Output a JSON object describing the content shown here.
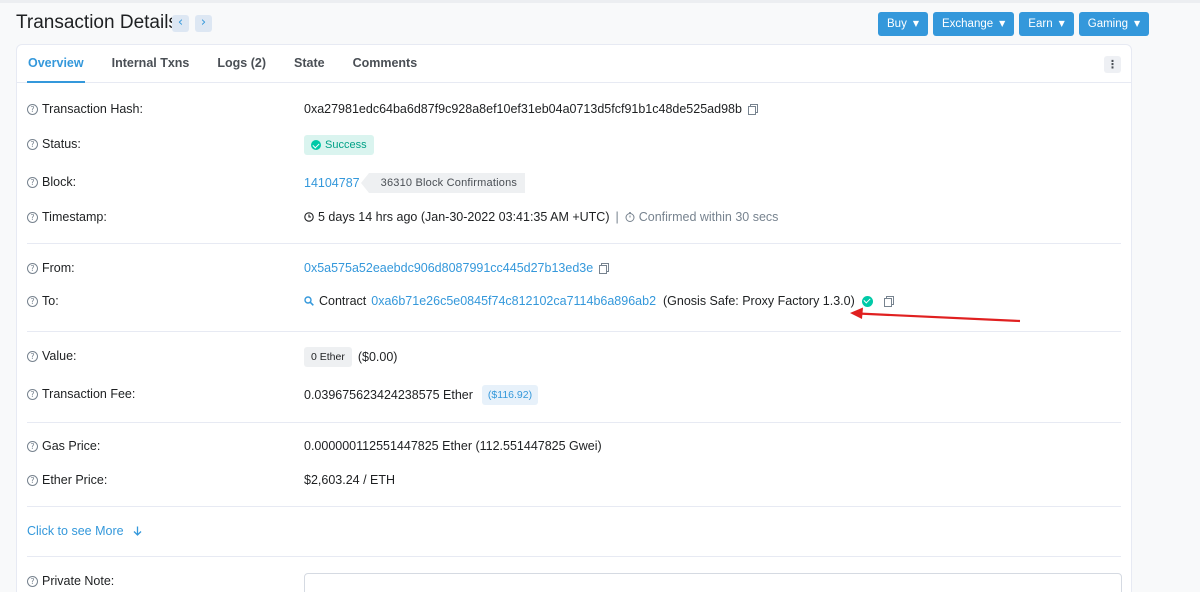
{
  "header": {
    "title": "Transaction Details",
    "prev_icon": "chevron-left-icon",
    "next_icon": "chevron-right-icon",
    "buttons": [
      {
        "label": "Buy"
      },
      {
        "label": "Exchange"
      },
      {
        "label": "Earn"
      },
      {
        "label": "Gaming"
      }
    ]
  },
  "tabs": [
    {
      "label": "Overview",
      "active": true
    },
    {
      "label": "Internal Txns"
    },
    {
      "label": "Logs (2)"
    },
    {
      "label": "State"
    },
    {
      "label": "Comments"
    }
  ],
  "menu_icon": "more-vertical-icon",
  "fields": {
    "hash": {
      "label": "Transaction Hash:",
      "value": "0xa27981edc64ba6d87f9c928a8ef10ef31eb04a0713d5fcf91b1c48de525ad98b"
    },
    "status": {
      "label": "Status:",
      "value": "Success"
    },
    "block": {
      "label": "Block:",
      "value": "14104787",
      "confirmations": "36310 Block Confirmations"
    },
    "timestamp": {
      "label": "Timestamp:",
      "value": "5 days 14 hrs ago (Jan-30-2022 03:41:35 AM +UTC)",
      "confirmed": "Confirmed within 30 secs"
    },
    "from": {
      "label": "From:",
      "value": "0x5a575a52eaebdc906d8087991cc445d27b13ed3e"
    },
    "to": {
      "label": "To:",
      "prefix": "Contract",
      "value": "0xa6b71e26c5e0845f74c812102ca7114b6a896ab2",
      "name": "(Gnosis Safe: Proxy Factory 1.3.0)"
    },
    "value": {
      "label": "Value:",
      "value": "0 Ether",
      "usd": "($0.00)"
    },
    "fee": {
      "label": "Transaction Fee:",
      "value": "0.039675623424238575 Ether",
      "usd": "($116.92)"
    },
    "gas": {
      "label": "Gas Price:",
      "value": "0.000000112551447825 Ether (112.551447825 Gwei)"
    },
    "ether_price": {
      "label": "Ether Price:",
      "value": "$2,603.24 / ETH"
    },
    "more": {
      "label": "Click to see More"
    },
    "note": {
      "label": "Private Note:"
    }
  },
  "colors": {
    "accent": "#3498db",
    "success": "#00c9a7",
    "annotation_arrow": "#e02020"
  }
}
